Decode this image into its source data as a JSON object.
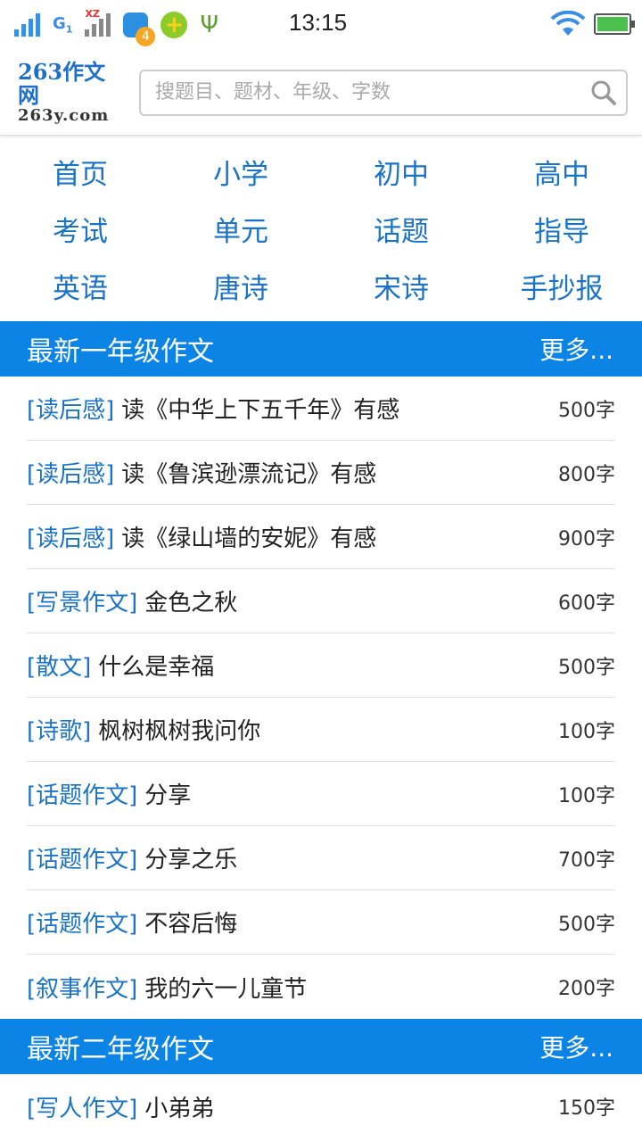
{
  "status_bar": {
    "network_label": "G",
    "network_sub": "1",
    "carrier_mark": "XZ",
    "notification_badge": "4",
    "time": "13:15"
  },
  "header": {
    "logo_main": "263作文网",
    "logo_sub": "263y.com",
    "search_placeholder": "搜题目、题材、年级、字数"
  },
  "nav": [
    {
      "label": "首页"
    },
    {
      "label": "小学"
    },
    {
      "label": "初中"
    },
    {
      "label": "高中"
    },
    {
      "label": "考试"
    },
    {
      "label": "单元"
    },
    {
      "label": "话题"
    },
    {
      "label": "指导"
    },
    {
      "label": "英语"
    },
    {
      "label": "唐诗"
    },
    {
      "label": "宋诗"
    },
    {
      "label": "手抄报"
    }
  ],
  "sections": [
    {
      "title": "最新一年级作文",
      "more": "更多...",
      "items": [
        {
          "category": "[读后感]",
          "title": "读《中华上下五千年》有感",
          "words": "500字"
        },
        {
          "category": "[读后感]",
          "title": "读《鲁滨逊漂流记》有感",
          "words": "800字"
        },
        {
          "category": "[读后感]",
          "title": "读《绿山墙的安妮》有感",
          "words": "900字"
        },
        {
          "category": "[写景作文]",
          "title": "金色之秋",
          "words": "600字"
        },
        {
          "category": "[散文]",
          "title": "什么是幸福",
          "words": "500字"
        },
        {
          "category": "[诗歌]",
          "title": "枫树枫树我问你",
          "words": "100字"
        },
        {
          "category": "[话题作文]",
          "title": "分享",
          "words": "100字"
        },
        {
          "category": "[话题作文]",
          "title": "分享之乐",
          "words": "700字"
        },
        {
          "category": "[话题作文]",
          "title": "不容后悔",
          "words": "500字"
        },
        {
          "category": "[叙事作文]",
          "title": "我的六一儿童节",
          "words": "200字"
        }
      ]
    },
    {
      "title": "最新二年级作文",
      "more": "更多...",
      "items": [
        {
          "category": "[写人作文]",
          "title": "小弟弟",
          "words": "150字"
        }
      ]
    }
  ],
  "colors": {
    "accent": "#0b84e6",
    "link": "#1a73c7"
  }
}
